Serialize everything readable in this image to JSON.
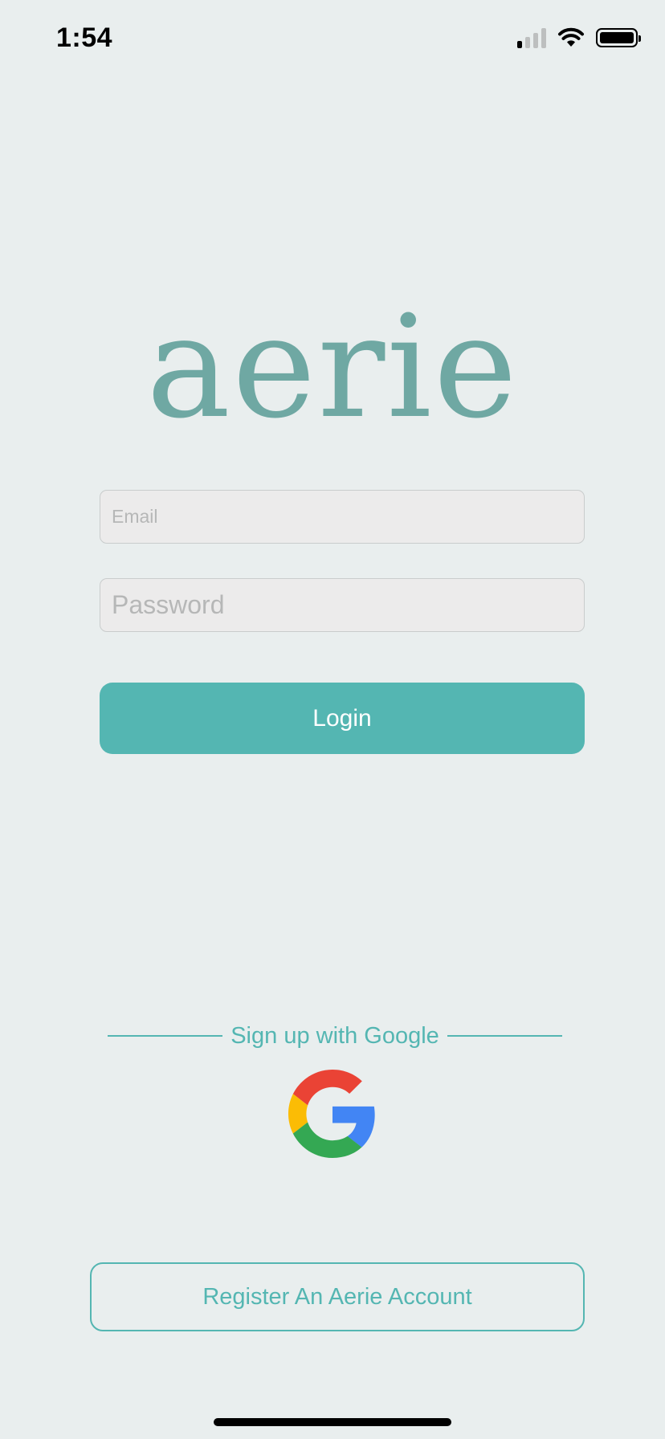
{
  "status_bar": {
    "time": "1:54"
  },
  "app": {
    "logo_text": "aerie",
    "brand_color": "#54B6B2",
    "logo_color": "#6FA8A3"
  },
  "login_form": {
    "email_placeholder": "Email",
    "password_placeholder": "Password",
    "login_label": "Login"
  },
  "google": {
    "divider_label": "Sign up with Google",
    "icon": "google-g-icon"
  },
  "register": {
    "label": "Register An Aerie Account"
  }
}
